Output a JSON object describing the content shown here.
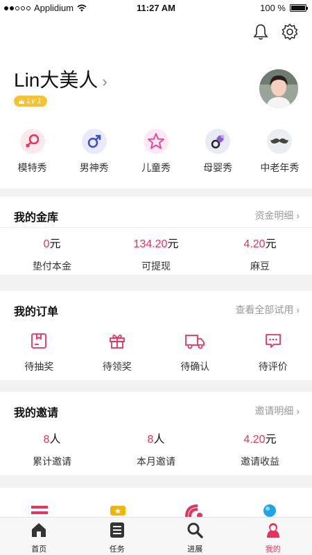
{
  "status": {
    "carrier": "Applidium",
    "time": "11:27 AM",
    "battery": "100 %"
  },
  "profile": {
    "name": "Lin大美人",
    "level": "Lv 1"
  },
  "categories": [
    {
      "label": "模特秀",
      "icon": "female-icon",
      "color": "#e7325e"
    },
    {
      "label": "男神秀",
      "icon": "male-icon",
      "color": "#3b4bd6"
    },
    {
      "label": "儿童秀",
      "icon": "star-icon",
      "color": "#e94a9a"
    },
    {
      "label": "母婴秀",
      "icon": "pacifier-icon",
      "color": "#8c5bd6"
    },
    {
      "label": "中老年秀",
      "icon": "mustache-icon",
      "color": "#444444"
    }
  ],
  "vault": {
    "title": "我的金库",
    "link": "资金明细",
    "stats": [
      {
        "value": "0",
        "unit": "元",
        "label": "垫付本金"
      },
      {
        "value": "134.20",
        "unit": "元",
        "label": "可提现"
      },
      {
        "value": "4.20",
        "unit": "元",
        "label": "麻豆"
      }
    ]
  },
  "orders": {
    "title": "我的订单",
    "link": "查看全部试用",
    "items": [
      {
        "label": "待抽奖",
        "icon": "lottery-box-icon"
      },
      {
        "label": "待领奖",
        "icon": "gift-icon"
      },
      {
        "label": "待确认",
        "icon": "truck-icon"
      },
      {
        "label": "待评价",
        "icon": "comment-icon"
      }
    ]
  },
  "invites": {
    "title": "我的邀请",
    "link": "邀请明细",
    "stats": [
      {
        "value": "8",
        "unit": "人",
        "label": "累计邀请"
      },
      {
        "value": "8",
        "unit": "人",
        "label": "本月邀请"
      },
      {
        "value": "4.20",
        "unit": "元",
        "label": "邀请收益"
      }
    ]
  },
  "tabs": [
    {
      "label": "首页",
      "icon": "home-icon"
    },
    {
      "label": "任务",
      "icon": "task-list-icon"
    },
    {
      "label": "进展",
      "icon": "search-icon"
    },
    {
      "label": "我的",
      "icon": "user-icon"
    }
  ],
  "colors": {
    "accent": "#e7325e",
    "badge": "#f7c22e"
  }
}
